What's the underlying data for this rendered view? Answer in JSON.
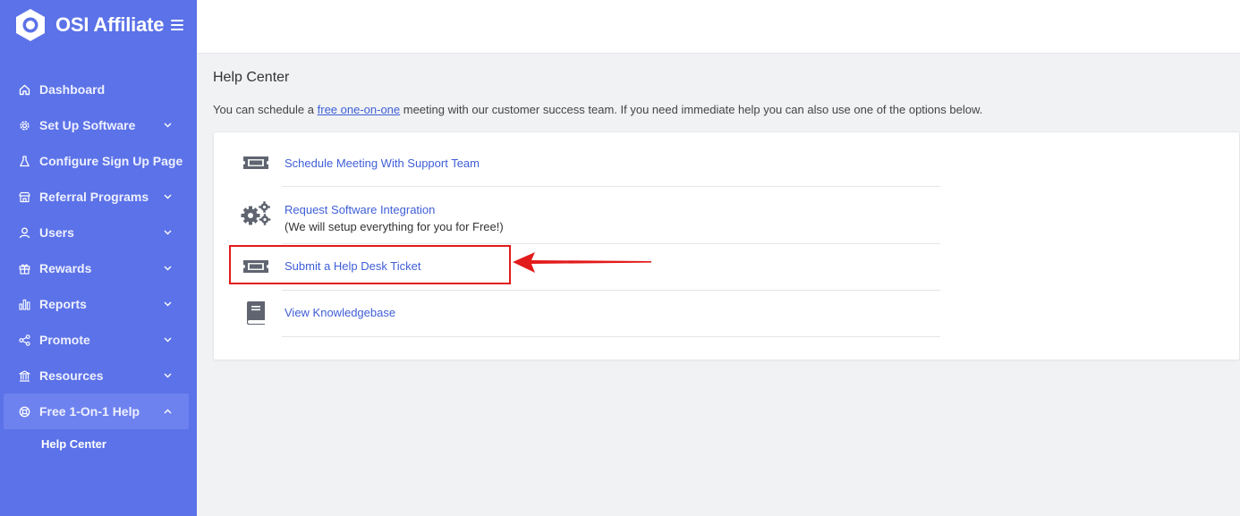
{
  "brand": {
    "name": "OSI Affiliate"
  },
  "sidebar": {
    "items": [
      {
        "label": "Dashboard",
        "icon": "home-icon",
        "has_chevron": false
      },
      {
        "label": "Set Up Software",
        "icon": "gear-icon",
        "has_chevron": true
      },
      {
        "label": "Configure Sign Up Page",
        "icon": "flask-icon",
        "has_chevron": false
      },
      {
        "label": "Referral Programs",
        "icon": "store-icon",
        "has_chevron": true
      },
      {
        "label": "Users",
        "icon": "user-icon",
        "has_chevron": true
      },
      {
        "label": "Rewards",
        "icon": "gift-icon",
        "has_chevron": true
      },
      {
        "label": "Reports",
        "icon": "bar-chart-icon",
        "has_chevron": true
      },
      {
        "label": "Promote",
        "icon": "share-icon",
        "has_chevron": true
      },
      {
        "label": "Resources",
        "icon": "bank-icon",
        "has_chevron": true
      },
      {
        "label": "Free 1-On-1 Help",
        "icon": "lifebuoy-icon",
        "has_chevron": true,
        "active": true
      }
    ],
    "sub_item": "Help Center"
  },
  "main": {
    "title": "Help Center",
    "intro_before": "You can schedule a ",
    "intro_link": "free one-on-one",
    "intro_after": " meeting with our customer success team. If you need immediate help you can also use one of the options below.",
    "options": [
      {
        "label": "Schedule Meeting With Support Team",
        "icon": "ticket-icon"
      },
      {
        "label": "Request Software Integration",
        "note": "(We will setup everything for you for Free!)",
        "icon": "cogs-icon"
      },
      {
        "label": "Submit a Help Desk Ticket",
        "icon": "ticket-icon"
      },
      {
        "label": "View Knowledgebase",
        "icon": "book-icon"
      }
    ]
  },
  "colors": {
    "sidebar": "#5b72e8",
    "active_item": "#6e82ef",
    "link": "#3f5ed8",
    "annotation": "#e21b1b",
    "icon": "#5f6470"
  }
}
